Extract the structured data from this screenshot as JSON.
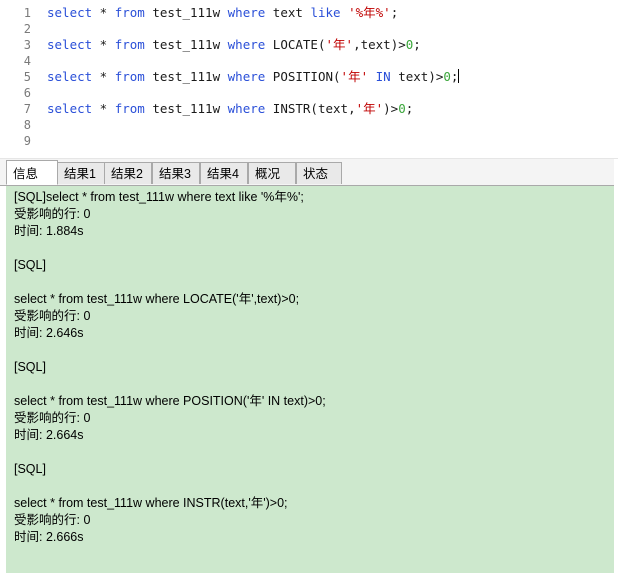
{
  "editor": {
    "lines": [
      {
        "num": "1",
        "tokens": [
          [
            "kw",
            "select"
          ],
          [
            "id",
            " * "
          ],
          [
            "kw",
            "from"
          ],
          [
            "id",
            " test_111w "
          ],
          [
            "kw",
            "where"
          ],
          [
            "id",
            " text "
          ],
          [
            "kw",
            "like"
          ],
          [
            "id",
            " "
          ],
          [
            "str",
            "'%年%'"
          ],
          [
            "id",
            ";"
          ]
        ]
      },
      {
        "num": "2",
        "tokens": []
      },
      {
        "num": "3",
        "tokens": [
          [
            "kw",
            "select"
          ],
          [
            "id",
            " * "
          ],
          [
            "kw",
            "from"
          ],
          [
            "id",
            " test_111w "
          ],
          [
            "kw",
            "where"
          ],
          [
            "id",
            " LOCATE("
          ],
          [
            "str",
            "'年'"
          ],
          [
            "id",
            ",text)>"
          ],
          [
            "num",
            "0"
          ],
          [
            "id",
            ";"
          ]
        ]
      },
      {
        "num": "4",
        "tokens": []
      },
      {
        "num": "5",
        "tokens": [
          [
            "kw",
            "select"
          ],
          [
            "id",
            " * "
          ],
          [
            "kw",
            "from"
          ],
          [
            "id",
            " test_111w "
          ],
          [
            "kw",
            "where"
          ],
          [
            "id",
            " POSITION("
          ],
          [
            "str",
            "'年'"
          ],
          [
            "id",
            " "
          ],
          [
            "kw",
            "IN"
          ],
          [
            "id",
            " text)>"
          ],
          [
            "num",
            "0"
          ],
          [
            "id",
            ";"
          ]
        ],
        "caret": true
      },
      {
        "num": "6",
        "tokens": []
      },
      {
        "num": "7",
        "tokens": [
          [
            "kw",
            "select"
          ],
          [
            "id",
            " * "
          ],
          [
            "kw",
            "from"
          ],
          [
            "id",
            " test_111w "
          ],
          [
            "kw",
            "where"
          ],
          [
            "id",
            " INSTR(text,"
          ],
          [
            "str",
            "'年'"
          ],
          [
            "id",
            ")>"
          ],
          [
            "num",
            "0"
          ],
          [
            "id",
            ";"
          ]
        ]
      },
      {
        "num": "8",
        "tokens": []
      },
      {
        "num": "9",
        "tokens": []
      }
    ]
  },
  "tabs": [
    "信息",
    "结果1",
    "结果2",
    "结果3",
    "结果4",
    "概况",
    "状态"
  ],
  "active_tab": 0,
  "output": [
    "[SQL]select * from test_111w where text like '%年%';",
    "受影响的行: 0",
    "时间: 1.884s",
    "",
    "[SQL]",
    "",
    "select * from test_111w where LOCATE('年',text)>0;",
    "受影响的行: 0",
    "时间: 2.646s",
    "",
    "[SQL]",
    "",
    "select * from test_111w where POSITION('年' IN text)>0;",
    "受影响的行: 0",
    "时间: 2.664s",
    "",
    "[SQL]",
    "",
    "select * from test_111w where INSTR(text,'年')>0;",
    "受影响的行: 0",
    "时间: 2.666s"
  ],
  "colors": {
    "keyword": "#2a4fd8",
    "string": "#c00000",
    "number": "#3aa63a",
    "output_bg": "#cde8cd"
  }
}
